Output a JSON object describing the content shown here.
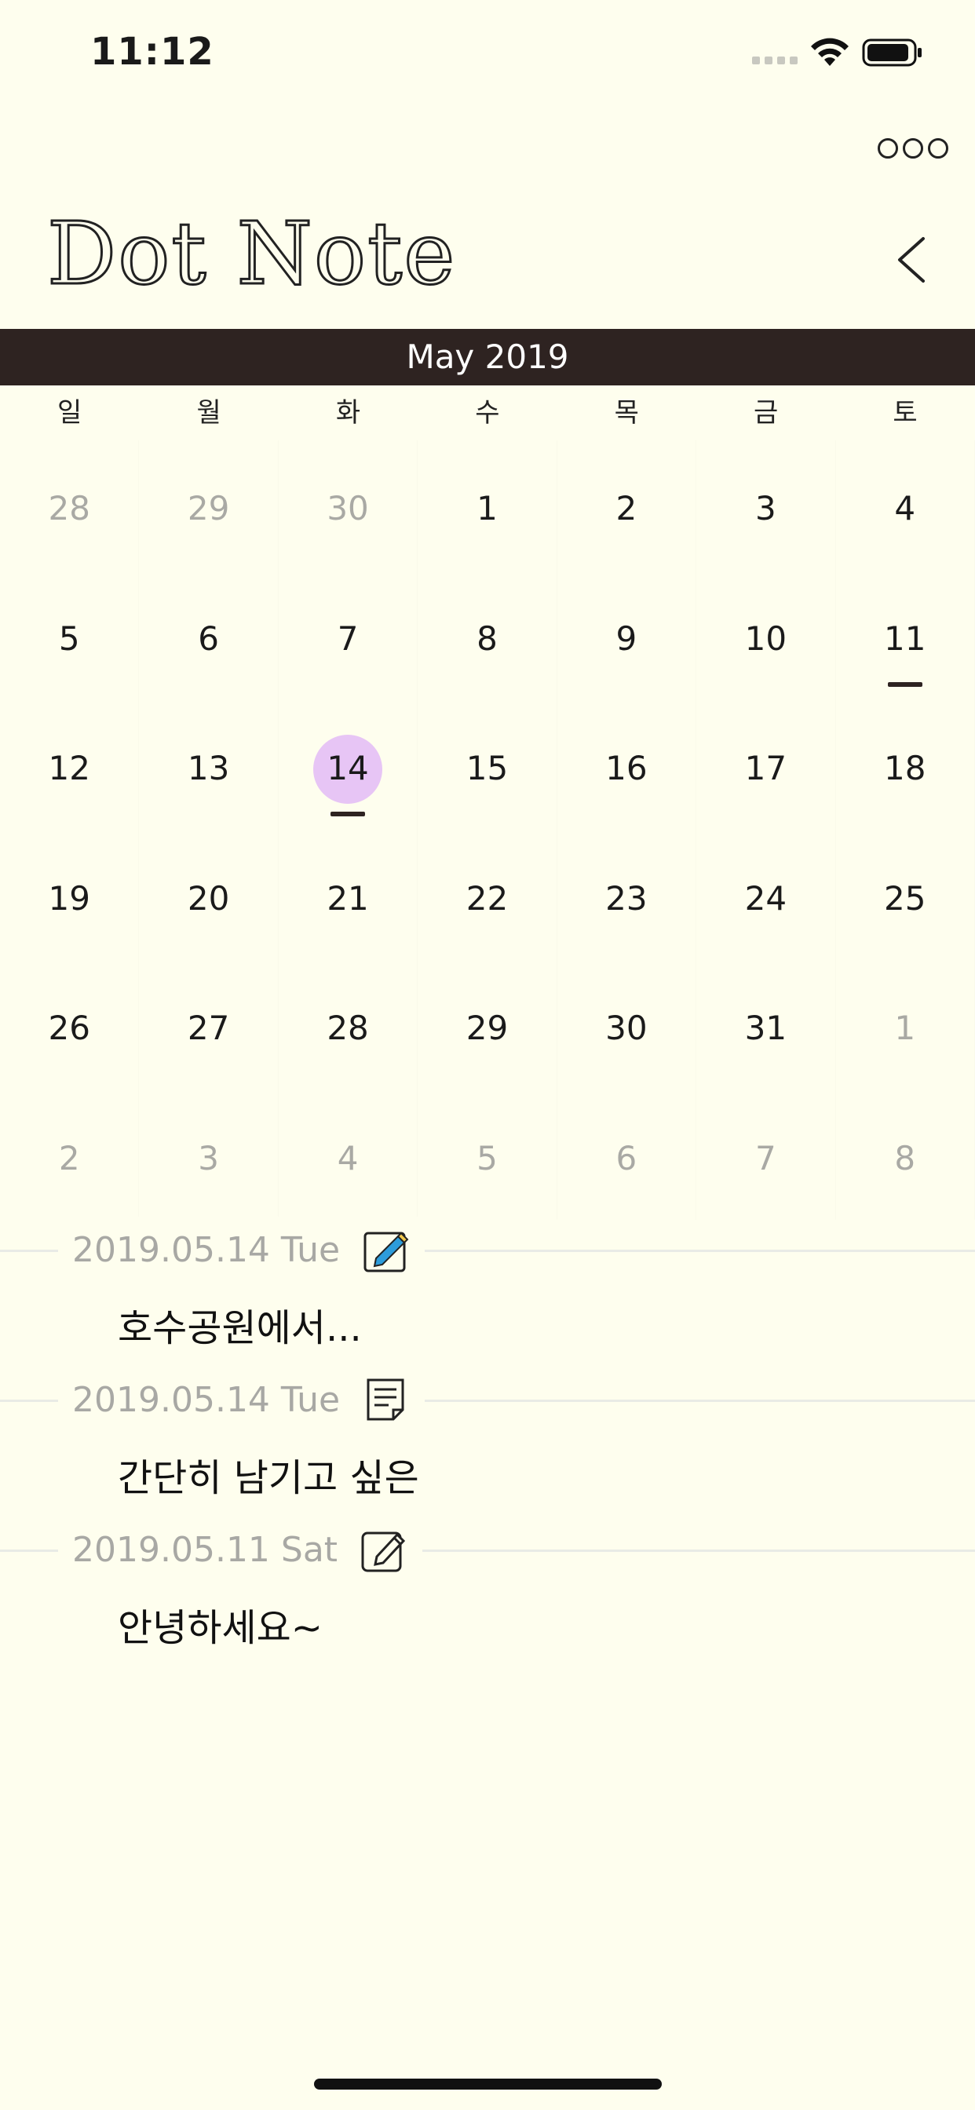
{
  "status": {
    "time": "11:12"
  },
  "app": {
    "title": "Dot Note"
  },
  "calendar": {
    "month_label": "May 2019",
    "weekdays": [
      "일",
      "월",
      "화",
      "수",
      "목",
      "금",
      "토"
    ],
    "weeks": [
      [
        "28",
        "29",
        "30",
        "1",
        "2",
        "3",
        "4"
      ],
      [
        "5",
        "6",
        "7",
        "8",
        "9",
        "10",
        "11"
      ],
      [
        "12",
        "13",
        "14",
        "15",
        "16",
        "17",
        "18"
      ],
      [
        "19",
        "20",
        "21",
        "22",
        "23",
        "24",
        "25"
      ],
      [
        "26",
        "27",
        "28",
        "29",
        "30",
        "31",
        "1"
      ],
      [
        "2",
        "3",
        "4",
        "5",
        "6",
        "7",
        "8"
      ]
    ],
    "selected_day": "14",
    "marked_days": [
      "11",
      "14"
    ],
    "selected_color": "#e7c5f5",
    "header_color": "#2e2321"
  },
  "entries": [
    {
      "date": "2019.05.14 Tue",
      "icon": "pencil-note-icon",
      "text": "호수공원에서..."
    },
    {
      "date": "2019.05.14 Tue",
      "icon": "document-icon",
      "text": "간단히 남기고 싶은"
    },
    {
      "date": "2019.05.11 Sat",
      "icon": "edit-icon",
      "text": "안녕하세요~"
    }
  ]
}
